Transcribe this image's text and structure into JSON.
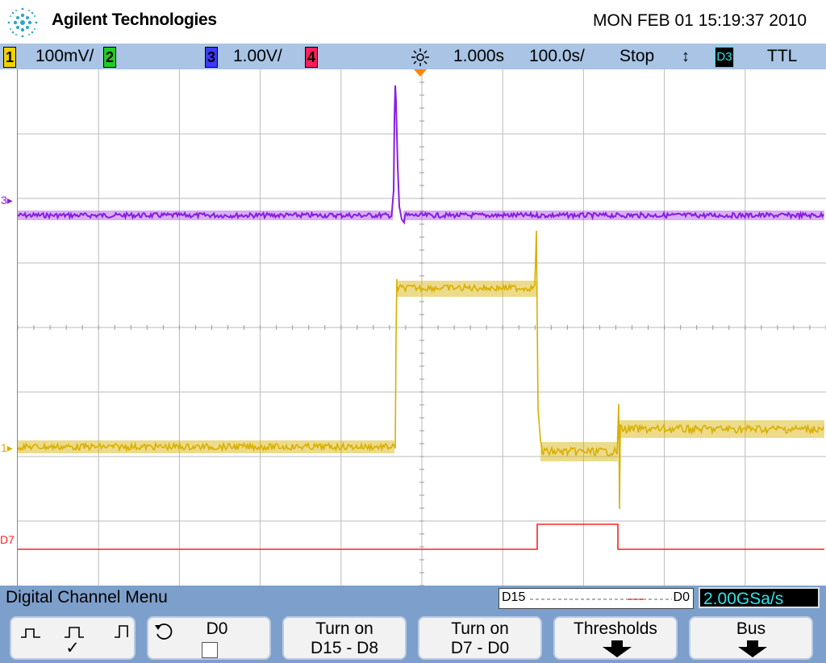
{
  "header": {
    "brand": "Agilent Technologies",
    "datetime": "MON FEB 01 15:19:37 2010"
  },
  "status": {
    "ch1": {
      "num": "1",
      "scale": "100mV/",
      "color": "#f2d000"
    },
    "ch2": {
      "num": "2",
      "color": "#22cc22"
    },
    "ch3": {
      "num": "3",
      "scale": "1.00V/",
      "color": "#3b3bff"
    },
    "ch4": {
      "num": "4",
      "color": "#ff1e5a"
    },
    "delay": "1.000s",
    "timebase": "100.0s/",
    "run_state": "Stop",
    "trigger_source": "D3",
    "trigger_level": "TTL"
  },
  "markers": {
    "ch3": "3",
    "ch1": "1",
    "d7": "D7"
  },
  "menu": {
    "title": "Digital Channel Menu",
    "indicator_left": "D15",
    "indicator_right": "D0",
    "sample_rate": "2.00GSa/s",
    "softkeys": [
      {
        "name": "threshold-type",
        "line1": "",
        "line2": "✓"
      },
      {
        "name": "channel-select",
        "line1": "D0",
        "line2": ""
      },
      {
        "name": "turn-on-d15-d8",
        "line1": "Turn on",
        "line2": "D15 - D8"
      },
      {
        "name": "turn-on-d7-d0",
        "line1": "Turn on",
        "line2": "D7 - D0"
      },
      {
        "name": "thresholds",
        "line1": "Thresholds",
        "line2": ""
      },
      {
        "name": "bus",
        "line1": "Bus",
        "line2": ""
      }
    ]
  },
  "colors": {
    "ch1_trace": "#d7b000",
    "ch3_trace": "#8a1ee0",
    "d7_trace": "#ff2020",
    "trigger_marker": "#ff8a00"
  }
}
